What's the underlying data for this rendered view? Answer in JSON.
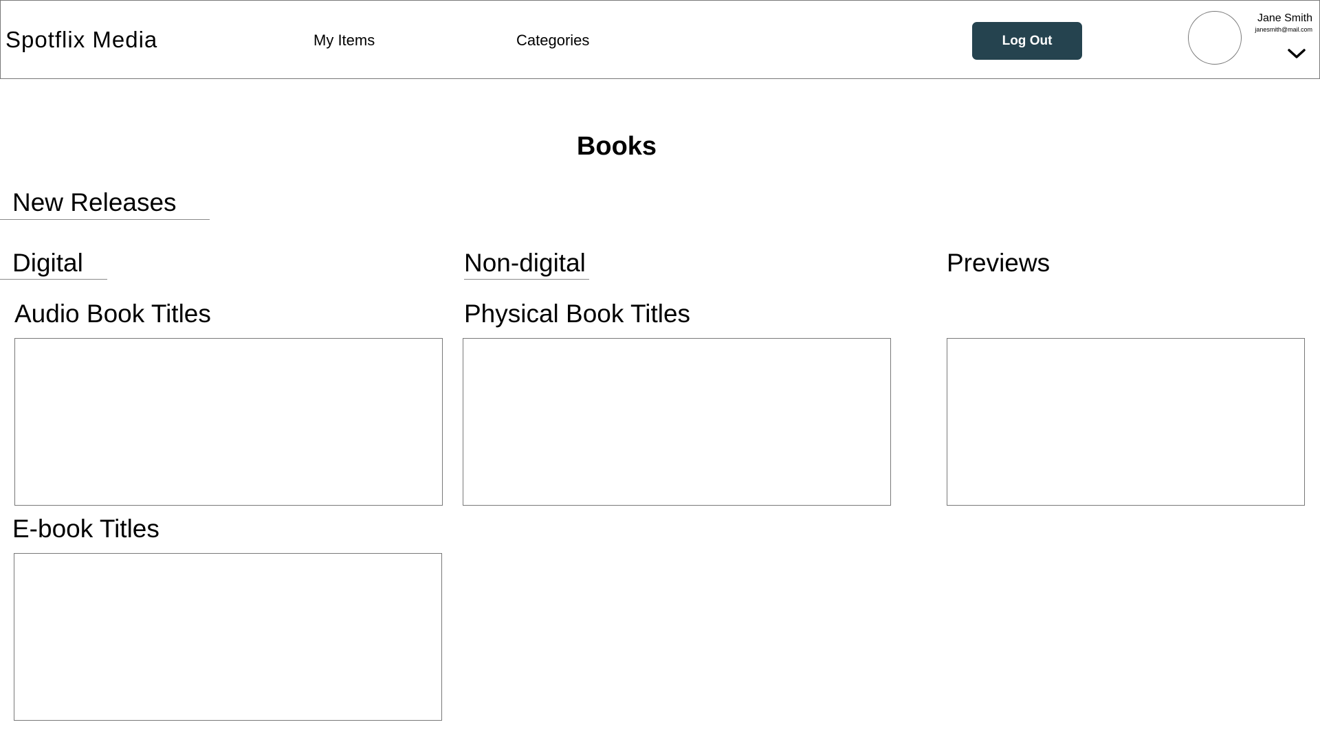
{
  "header": {
    "logo": "Spotflix Media",
    "nav": {
      "my_items": "My Items",
      "categories": "Categories"
    },
    "logout_label": "Log Out",
    "user": {
      "name": "Jane Smith",
      "email": "janesmith@mail.com"
    }
  },
  "main": {
    "title": "Books",
    "new_releases": "New Releases",
    "tabs": {
      "digital": "Digital",
      "non_digital": "Non-digital",
      "previews": "Previews"
    },
    "sections": {
      "audio": "Audio Book Titles",
      "physical": "Physical Book Titles",
      "ebook": "E-book Titles"
    }
  },
  "colors": {
    "button_bg": "#25434f",
    "border": "#777777"
  },
  "icons": {
    "dropdown": "chevron-down-icon",
    "avatar": "avatar"
  }
}
